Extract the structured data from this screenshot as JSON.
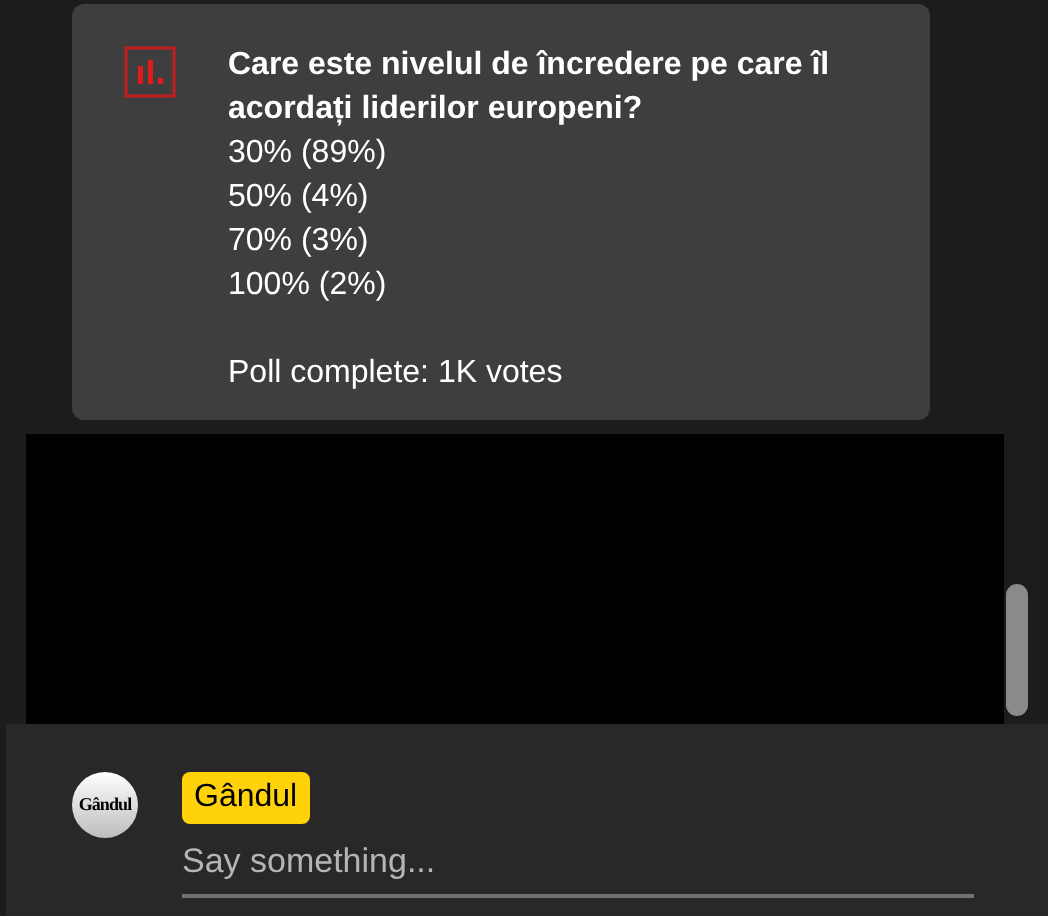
{
  "poll_card": {
    "question": "Care este nivelul de încredere pe care îl acordați liderilor europeni?",
    "options": [
      "30% (89%)",
      "50% (4%)",
      "70% (3%)",
      "100% (2%)"
    ],
    "footer": "Poll complete: 1K votes"
  },
  "composer": {
    "avatar_logo": "Gândul",
    "author": "Gândul",
    "placeholder": "Say something..."
  }
}
